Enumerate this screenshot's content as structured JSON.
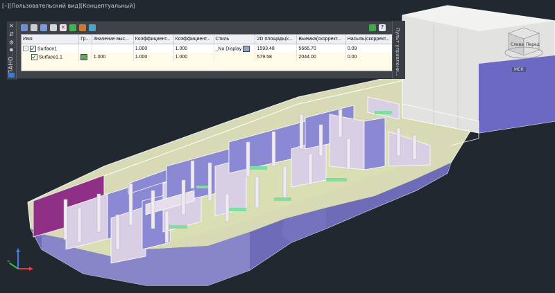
{
  "viewport": {
    "label": "[–][Пользовательский вид][Концептуальный]"
  },
  "palette": {
    "title": "ПАНО...",
    "side_label": "Пульт управлени...",
    "columns": [
      "Имя",
      "Гр...",
      "Значение выс...",
      "Коэффициент...",
      "Коэффициент...",
      "Стиль",
      "2D площадь(к...",
      "Выемка(скоррект...",
      "Насыпь(скоррект..."
    ],
    "rows": [
      {
        "name": "Surface1",
        "group": "",
        "elev": "",
        "coef1": "1.000",
        "coef2": "1.000",
        "style": "_No Display",
        "area2d": "1593.48",
        "cut": "5666.70",
        "fill": "0.09"
      },
      {
        "name": "Surface1.1",
        "group": "",
        "elev": "1.000",
        "coef1": "1.000",
        "coef2": "1.000",
        "style": "",
        "area2d": "579.58",
        "cut": "2044.00",
        "fill": "0.00"
      }
    ]
  },
  "viewcube": {
    "face_left": "Слева",
    "face_front": "Перед"
  },
  "wcs_label": "МСК",
  "colors": {
    "background": "#212830",
    "wall_purple": "#8b88d3",
    "wall_light": "#e9e3e9",
    "floor": "#d8deb0",
    "magenta": "#8f2f86",
    "green_strip": "#7fdfa3"
  }
}
